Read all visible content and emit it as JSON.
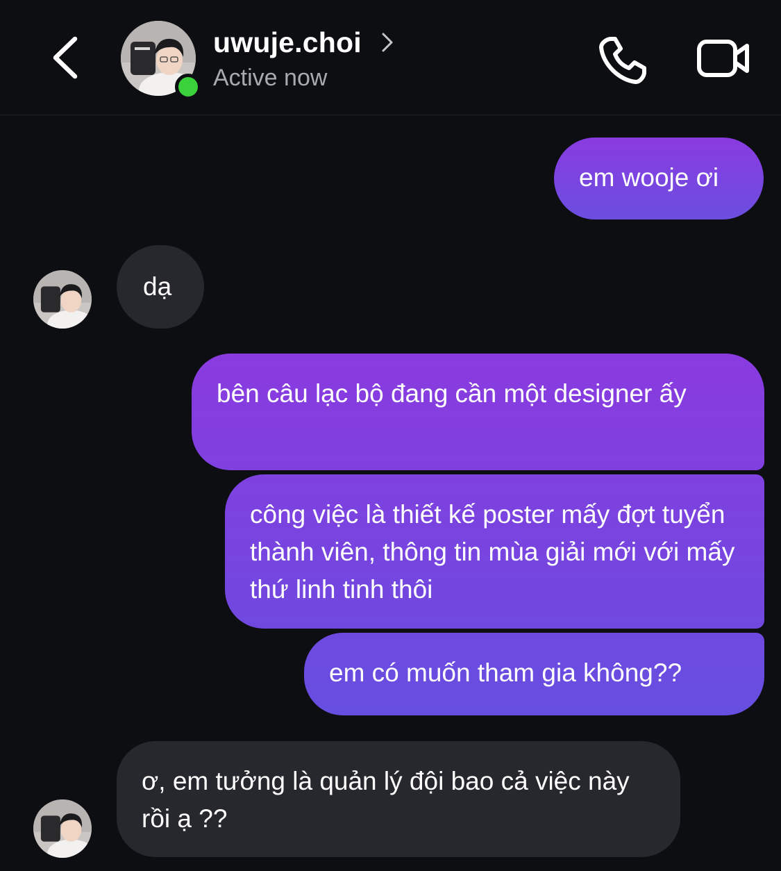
{
  "header": {
    "contact_name": "uwuje.choi",
    "status": "Active now",
    "back_icon": "chevron-left-icon",
    "call_icon": "phone-icon",
    "video_icon": "video-camera-icon",
    "online_color": "#3ad13a"
  },
  "messages": [
    {
      "direction": "sent",
      "text": "em wooje ơi"
    },
    {
      "direction": "received",
      "text": "dạ"
    },
    {
      "direction": "sent",
      "text": "bên câu lạc bộ đang cần một designer ấy"
    },
    {
      "direction": "sent",
      "text": "công việc là thiết kế poster mấy đợt tuyển thành viên, thông tin mùa giải mới với mấy thứ linh tinh thôi"
    },
    {
      "direction": "sent",
      "text": "em có muốn tham gia không??"
    },
    {
      "direction": "received",
      "text": "ơ, em tưởng là quản lý đội bao cả việc này rồi ạ ??"
    }
  ],
  "colors": {
    "background": "#0c0e12",
    "sent_gradient_top": "#8a3be0",
    "sent_gradient_bottom": "#6b4ee0",
    "received_bubble": "#26282d",
    "status_text": "#a8aab0"
  }
}
